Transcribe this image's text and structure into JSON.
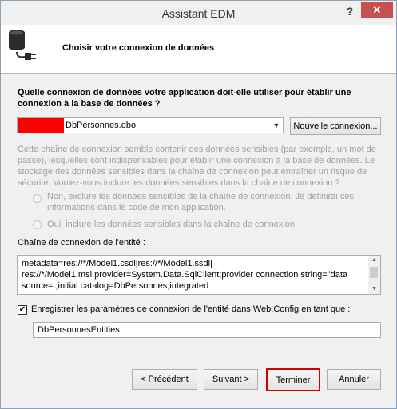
{
  "window": {
    "title": "Assistant EDM",
    "help_label": "?",
    "close_label": "✕"
  },
  "header": {
    "title": "Choisir votre connexion de données",
    "icon": "database-plug-icon"
  },
  "question": "Quelle connexion de données votre application doit-elle utiliser pour établir une connexion à la base de données ?",
  "connection_select": {
    "value": "DbPersonnes.dbo"
  },
  "new_connection_label": "Nouvelle connexion...",
  "warning_text": "Cette chaîne de connexion semble contenir des données sensibles (par exemple, un mot de passe), lesquelles sont indispensables pour établir une connexion à la base de données. Le stockage des données sensibles dans la chaîne de connexion peut entraîner un risque de sécurité. Voulez-vous inclure les données sensibles dans la chaîne de connexion ?",
  "radio_exclude_label": "Non, exclure les données sensibles de la chaîne de connexion. Je définirai ces informations dans le code de mon application.",
  "radio_include_label": "Oui, inclure les données sensibles dans la chaîne de connexion.",
  "entity_connection_label": "Chaîne de connexion de l'entité :",
  "entity_connection_string": "metadata=res://*/Model1.csdl|res://*/Model1.ssdl|\nres://*/Model1.msl;provider=System.Data.SqlClient;provider connection string=\"data\nsource=.;initial catalog=DbPersonnes;integrated",
  "save_checkbox": {
    "label": "Enregistrer les paramètres de connexion de l'entité dans Web.Config en tant que :",
    "checked": true
  },
  "entities_name": "DbPersonnesEntities",
  "buttons": {
    "previous": "< Précédent",
    "next": "Suivant >",
    "finish": "Terminer",
    "cancel": "Annuler"
  },
  "colors": {
    "close": "#c75050",
    "highlight": "#d00000",
    "redaction": "#ff0000",
    "disabled_text": "#a0a0a0"
  }
}
